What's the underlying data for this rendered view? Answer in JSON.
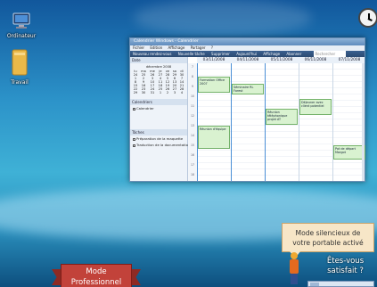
{
  "desktop_icons": [
    {
      "label": "Ordinateur",
      "icon": "computer-icon"
    },
    {
      "label": "Travail",
      "icon": "folder-icon"
    }
  ],
  "window": {
    "title": "Calendrier Windows - Calendrier",
    "menu": [
      "Fichier",
      "Edition",
      "Affichage",
      "Partager",
      "?"
    ],
    "toolbar": [
      "Nouveau rendez-vous",
      "Nouvelle tâche",
      "Supprimer",
      "Aujourd'hui",
      "Affichage",
      "Abonner"
    ],
    "search_placeholder": "Rechercher",
    "sidebar": {
      "date_header": "Date",
      "month_label": "décembre 2008",
      "weekdays": [
        "lu",
        "ma",
        "me",
        "je",
        "ve",
        "sa",
        "di"
      ],
      "weeks": [
        [
          "24",
          "25",
          "26",
          "27",
          "28",
          "29",
          "30"
        ],
        [
          "1",
          "2",
          "3",
          "4",
          "5",
          "6",
          "7"
        ],
        [
          "8",
          "9",
          "10",
          "11",
          "12",
          "13",
          "14"
        ],
        [
          "15",
          "16",
          "17",
          "18",
          "19",
          "20",
          "21"
        ],
        [
          "22",
          "23",
          "24",
          "25",
          "26",
          "27",
          "28"
        ],
        [
          "29",
          "30",
          "31",
          "1",
          "2",
          "3",
          "4"
        ]
      ],
      "calendars_header": "Calendriers",
      "calendar_item": "Calendrier",
      "tasks_header": "Tâches",
      "tasks": [
        "Préparation de la maquette",
        "Traduction de la documentation"
      ]
    },
    "day_headers": [
      "03/11/2008",
      "04/11/2008",
      "05/11/2008",
      "06/11/2008",
      "07/11/2008"
    ],
    "hours": [
      "7",
      "8",
      "9",
      "10",
      "11",
      "12",
      "13",
      "14",
      "15",
      "16",
      "17",
      "18"
    ],
    "events": [
      {
        "text": "Formation Office 2007"
      },
      {
        "text": "Séminaire RL Forest"
      },
      {
        "text": "Réunion téléphonique projet AT"
      },
      {
        "text": "Déjeuner avec client potentiel"
      },
      {
        "text": "Réunion d'équipe"
      },
      {
        "text": "Pot de départ Margot"
      }
    ]
  },
  "callout": {
    "line1": "Mode silencieux de",
    "line2": "votre portable activé"
  },
  "satisfaction": {
    "line1": "Êtes-vous",
    "line2": "satisfait ?"
  },
  "ribbon": {
    "line1": "Mode",
    "line2": "Professionnel"
  }
}
